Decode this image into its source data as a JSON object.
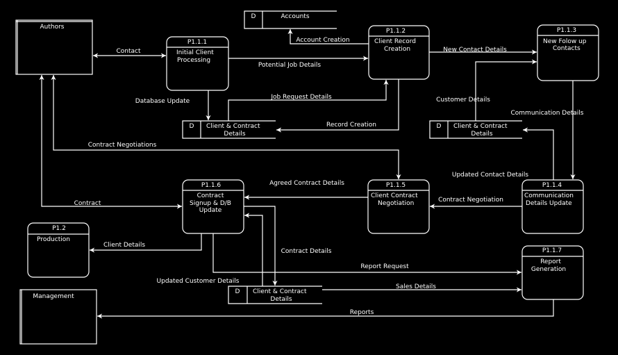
{
  "colors": {
    "background": "#000000",
    "foreground": "#ffffff"
  },
  "entities": {
    "authors": "Authors",
    "management": "Management"
  },
  "processes": {
    "p111": {
      "id": "P1.1.1",
      "l1": "Initial Client",
      "l2": "Processing"
    },
    "p112": {
      "id": "P1.1.2",
      "l1": "Client Record",
      "l2": "Creation"
    },
    "p113": {
      "id": "P1.1.3",
      "l1": "New Folow up",
      "l2": "Contacts"
    },
    "p114": {
      "id": "P1.1.4",
      "l1": "Communication",
      "l2": "Details Update"
    },
    "p115": {
      "id": "P1.1.5",
      "l1": "Client Contract",
      "l2": "Negotiation"
    },
    "p116": {
      "id": "P1.1.6",
      "l1": "Contract",
      "l2": "Signup & D/B",
      "l3": "Update"
    },
    "p117": {
      "id": "P1.1.7",
      "l1": "Report",
      "l2": "Generation"
    },
    "p12": {
      "id": "P1.2",
      "l1": "Production"
    }
  },
  "stores": {
    "accounts": {
      "code": "D",
      "l1": "Accounts"
    },
    "cc1": {
      "code": "D",
      "l1": "Client & Contract",
      "l2": "Details"
    },
    "cc2": {
      "code": "D",
      "l1": "Client & Contract",
      "l2": "Details"
    },
    "cc3": {
      "code": "D",
      "l1": "Client & Contract",
      "l2": "Details"
    }
  },
  "flows": {
    "contact": "Contact",
    "potential_job": "Potential Job Details",
    "account_creation": "Account Creation",
    "new_contact": "New Contact Details",
    "database_update": "Database Update",
    "job_request": "Job Request Details",
    "record_creation": "Record Creation",
    "customer_details": "Customer Details",
    "communication_details": "Communication Details",
    "contract_negotiations": "Contract Negotiations",
    "updated_contact": "Updated Contact Details",
    "agreed_contract": "Agreed Contract Details",
    "contract": "Contract",
    "contract_negotiation": "Contract Negotiation",
    "client_details": "Client Details",
    "contract_details": "Contract Details",
    "report_request": "Report Request",
    "updated_customer": "Updated Customer Details",
    "sales_details": "Sales Details",
    "reports": "Reports"
  }
}
